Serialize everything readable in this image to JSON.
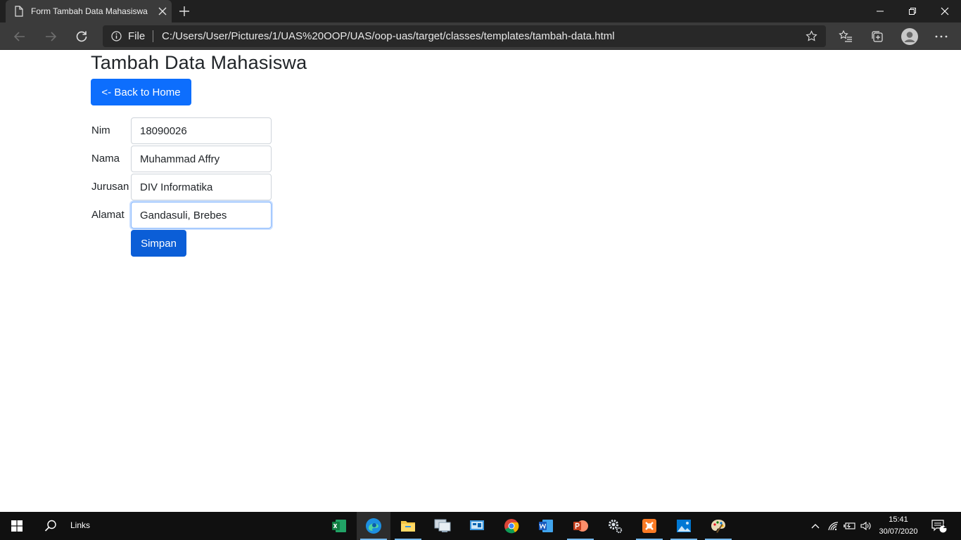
{
  "browser": {
    "tab_title": "Form Tambah Data Mahasiswa",
    "address_scheme": "File",
    "address_url": "C:/Users/User/Pictures/1/UAS%20OOP/UAS/oop-uas/target/classes/templates/tambah-data.html"
  },
  "page": {
    "title": "Tambah Data Mahasiswa",
    "back_button": "<- Back to Home",
    "form": {
      "fields": [
        {
          "label": "Nim",
          "value": "18090026"
        },
        {
          "label": "Nama",
          "value": "Muhammad Affry"
        },
        {
          "label": "Jurusan",
          "value": "DIV Informatika"
        },
        {
          "label": "Alamat",
          "value": "Gandasuli, Brebes"
        }
      ],
      "submit_label": "Simpan"
    }
  },
  "taskbar": {
    "links_label": "Links",
    "time": "15:41",
    "date": "30/07/2020",
    "notification_count": "1"
  },
  "colors": {
    "primary": "#0d6efd",
    "primary_dark": "#0b5ed7",
    "chrome_dark": "#202020",
    "toolbar": "#3b3b3b"
  }
}
